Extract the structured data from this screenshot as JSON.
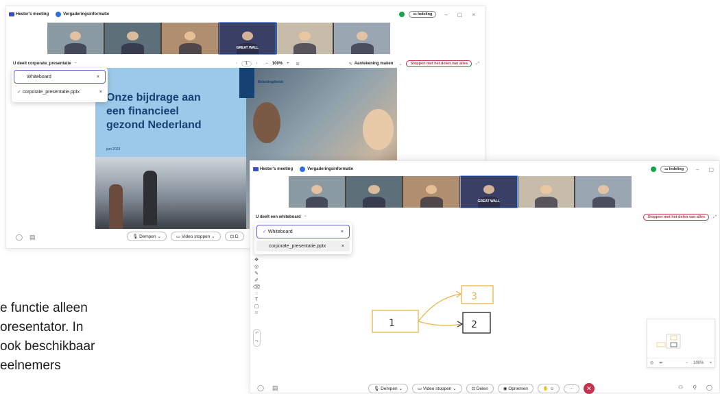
{
  "window1": {
    "meeting_title": "Hester's meeting",
    "info_label": "Vergaderingsinformatie",
    "layout_label": "Indeling",
    "share_label": "U deelt corporate_presentatie",
    "page_number": "1",
    "zoom": "100%",
    "annotate_label": "Aantekening maken",
    "stop_label": "Stoppen met het delen van alles",
    "share_list": [
      {
        "label": "Whiteboard",
        "selected": false
      },
      {
        "label": "corporate_presentatie.pptx",
        "selected": true
      }
    ],
    "slide": {
      "title_lines": [
        "Onze bijdrage aan",
        "een financieel",
        "gezond Nederland"
      ],
      "date": "juni 2023",
      "org": "Belastingdienst"
    },
    "toolbar": {
      "mute": "Dempen",
      "video": "Video stoppen",
      "share": "D"
    },
    "video_tile_caption": "GREAT WALL"
  },
  "window2": {
    "meeting_title": "Hester's meeting",
    "info_label": "Vergaderingsinformatie",
    "layout_label": "Indeling",
    "share_label": "U deelt een whiteboard",
    "stop_label": "Stoppen met het delen van alles",
    "share_list": [
      {
        "label": "Whiteboard",
        "selected": true
      },
      {
        "label": "corporate_presentatie.pptx",
        "selected": false
      }
    ],
    "whiteboard_nodes": [
      "1",
      "2",
      "3"
    ],
    "minimap_zoom": "100%",
    "toolbar": {
      "mute": "Dempen",
      "video": "Video stoppen",
      "share": "Delen",
      "record": "Opnemen"
    },
    "video_tile_caption": "GREAT WALL"
  },
  "caption_lines": [
    "e functie alleen",
    "oresentator. In",
    " ook beschikbaar",
    "eelnemers"
  ],
  "colors": {
    "accent": "#5b5fc7",
    "stop": "#c4314b",
    "slide_blue": "#9cc9e9",
    "whiteboard_yellow": "#e8b54a"
  }
}
